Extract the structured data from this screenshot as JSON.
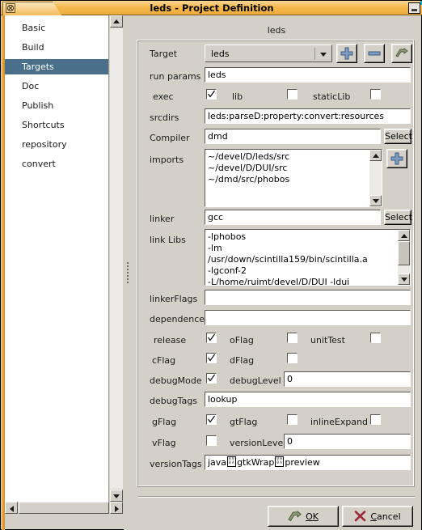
{
  "window": {
    "title": "leds - Project Definition",
    "close_icon": "close-box-icon",
    "minimize_icon": "minimize-icon"
  },
  "sidebar": {
    "items": [
      {
        "label": "Basic",
        "selected": false
      },
      {
        "label": "Build",
        "selected": false
      },
      {
        "label": "Targets",
        "selected": true
      },
      {
        "label": "Doc",
        "selected": false
      },
      {
        "label": "Publish",
        "selected": false
      },
      {
        "label": "Shortcuts",
        "selected": false
      },
      {
        "label": "repository",
        "selected": false
      },
      {
        "label": "convert",
        "selected": false
      }
    ]
  },
  "panel": {
    "title": "leds",
    "target": {
      "label": "Target",
      "value": "leds",
      "add_icon": "plus-icon",
      "remove_icon": "minus-icon",
      "apply_icon": "green-arrow-icon"
    },
    "run_params": {
      "label": "run params",
      "value": "leds"
    },
    "exec_row": {
      "label": "exec",
      "checked": true,
      "lib_label": "lib",
      "lib_checked": false,
      "staticlib_label": "staticLib",
      "staticlib_checked": false
    },
    "srcdirs": {
      "label": "srcdirs",
      "value": "leds:parseD:property:convert:resources"
    },
    "compiler": {
      "label": "Compiler",
      "value": "dmd",
      "select_label": "Select"
    },
    "imports": {
      "label": "imports",
      "items": [
        "~/devel/D/leds/src",
        "~/devel/D/DUI/src",
        "~/dmd/src/phobos"
      ],
      "add_icon": "plus-icon"
    },
    "linker": {
      "label": "linker",
      "value": "gcc",
      "select_label": "Select"
    },
    "link_libs": {
      "label": "link Libs",
      "items": [
        "-lphobos",
        "-lm",
        "/usr/down/scintilla159/bin/scintilla.a",
        "-lgconf-2",
        "-L/home/ruimt/devel/D/DUI -ldui"
      ]
    },
    "linker_flags": {
      "label": "linkerFlags",
      "value": ""
    },
    "dependences": {
      "label": "dependences",
      "value": ""
    },
    "release_row": {
      "label": "release",
      "checked": true,
      "oflag_label": "oFlag",
      "oflag_checked": false,
      "unittest_label": "unitTest",
      "unittest_checked": false
    },
    "cflag_row": {
      "label": "cFlag",
      "checked": true,
      "dflag_label": "dFlag",
      "dflag_checked": false
    },
    "debugmode_row": {
      "label": "debugMode",
      "checked": true,
      "debuglevel_label": "debugLevel",
      "debuglevel_value": "0"
    },
    "debugtags": {
      "label": "debugTags",
      "value": "lookup"
    },
    "gflag_row": {
      "label": "gFlag",
      "checked": true,
      "gtflag_label": "gtFlag",
      "gtflag_checked": false,
      "inlineexpand_label": "inlineExpand",
      "inlineexpand_checked": false
    },
    "vflag_row": {
      "label": "vFlag",
      "checked": false,
      "versionlevel_label": "versionLevel",
      "versionlevel_value": "0"
    },
    "versiontags": {
      "label": "versionTags",
      "part1": "java",
      "part2": "gtkWrap",
      "part3": "preview"
    }
  },
  "footer": {
    "ok_label": "OK",
    "ok_icon": "green-arrow-icon",
    "cancel_label": "Cancel",
    "cancel_icon": "red-x-icon"
  },
  "colors": {
    "titlebar": "#f5b94e",
    "selection": "#4a6f8a",
    "face": "#d4d0c8",
    "field": "#ffffff",
    "icon_blue": "#6f8fb8",
    "icon_green": "#8a9a74",
    "icon_red": "#a8384a"
  }
}
